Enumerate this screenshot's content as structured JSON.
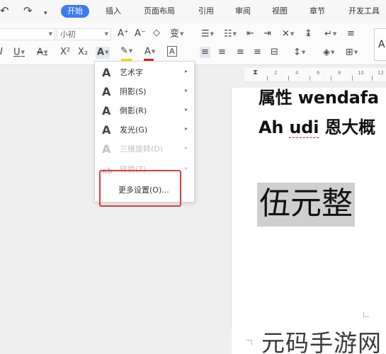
{
  "quick_access": {
    "undo_glyph": "↶",
    "redo_glyph": "↷",
    "more_glyph": "▾"
  },
  "tabs": [
    {
      "label": "开始",
      "active": true
    },
    {
      "label": "插入",
      "active": false
    },
    {
      "label": "页面布局",
      "active": false
    },
    {
      "label": "引用",
      "active": false
    },
    {
      "label": "审阅",
      "active": false
    },
    {
      "label": "视图",
      "active": false
    },
    {
      "label": "章节",
      "active": false
    },
    {
      "label": "开发工具",
      "active": false
    }
  ],
  "toolbar": {
    "font_size_value": "小初",
    "font_grow_glyph": "A⁺",
    "font_shrink_glyph": "A⁻",
    "clear_format_glyph": "◇",
    "phonetic_glyph": "变",
    "italic_glyph": "I",
    "underline_glyph": "U",
    "strike_glyph": "A",
    "superscript_glyph": "X²",
    "subscript_glyph": "X₂",
    "text_effect_glyph": "A",
    "highlight_glyph": "✎",
    "font_color_glyph": "A",
    "char_border_glyph": "A",
    "bullets_glyph": "☰",
    "numbering_glyph": "☷",
    "decrease_indent_glyph": "⇤",
    "increase_indent_glyph": "⇥",
    "chinese_layout_glyph": "✕",
    "line_spacing2_glyph": "↨",
    "show_marks_glyph": "↵",
    "align_left_glyph": "≡",
    "align_center_glyph": "≡",
    "align_right_glyph": "≡",
    "justify_glyph": "≡",
    "distributed_glyph": "⊟",
    "line_spacing_glyph": "↕",
    "shading_glyph": "◈",
    "borders_glyph": "⊞",
    "preview_glyph": "A",
    "colors": {
      "highlight": "#f5d800",
      "font_color": "#e02020",
      "accent_tab": "#3d7bf0"
    }
  },
  "text_effect_menu": {
    "items": [
      {
        "label": "艺术字",
        "icon": "A",
        "icon_name": "wordart-icon",
        "disabled": false
      },
      {
        "label": "阴影(S)",
        "icon": "A",
        "icon_name": "shadow-icon",
        "disabled": false
      },
      {
        "label": "倒影(R)",
        "icon": "A",
        "icon_name": "reflection-icon",
        "disabled": false
      },
      {
        "label": "发光(G)",
        "icon": "A",
        "icon_name": "glow-icon",
        "disabled": false
      },
      {
        "label": "三维旋转(D)",
        "icon": "A",
        "icon_name": "3d-rotation-icon",
        "disabled": true
      },
      {
        "label": "转换(T)",
        "icon": "ab",
        "icon_name": "transform-icon",
        "disabled": true
      }
    ],
    "more_settings_label": "更多设置(O)...",
    "submenu_arrow": "▸"
  },
  "ruler": {
    "ticks": [
      "2",
      "4",
      "6",
      "8",
      "10",
      "12"
    ]
  },
  "document": {
    "line1_prefix": "属性 ",
    "line1_word": "wendafa",
    "line2_word1": "Ah ",
    "line2_word2": "udi",
    "line2_suffix": " 恩大概",
    "selected_text": "伍元整"
  },
  "watermark": {
    "text": "元码手游网"
  }
}
